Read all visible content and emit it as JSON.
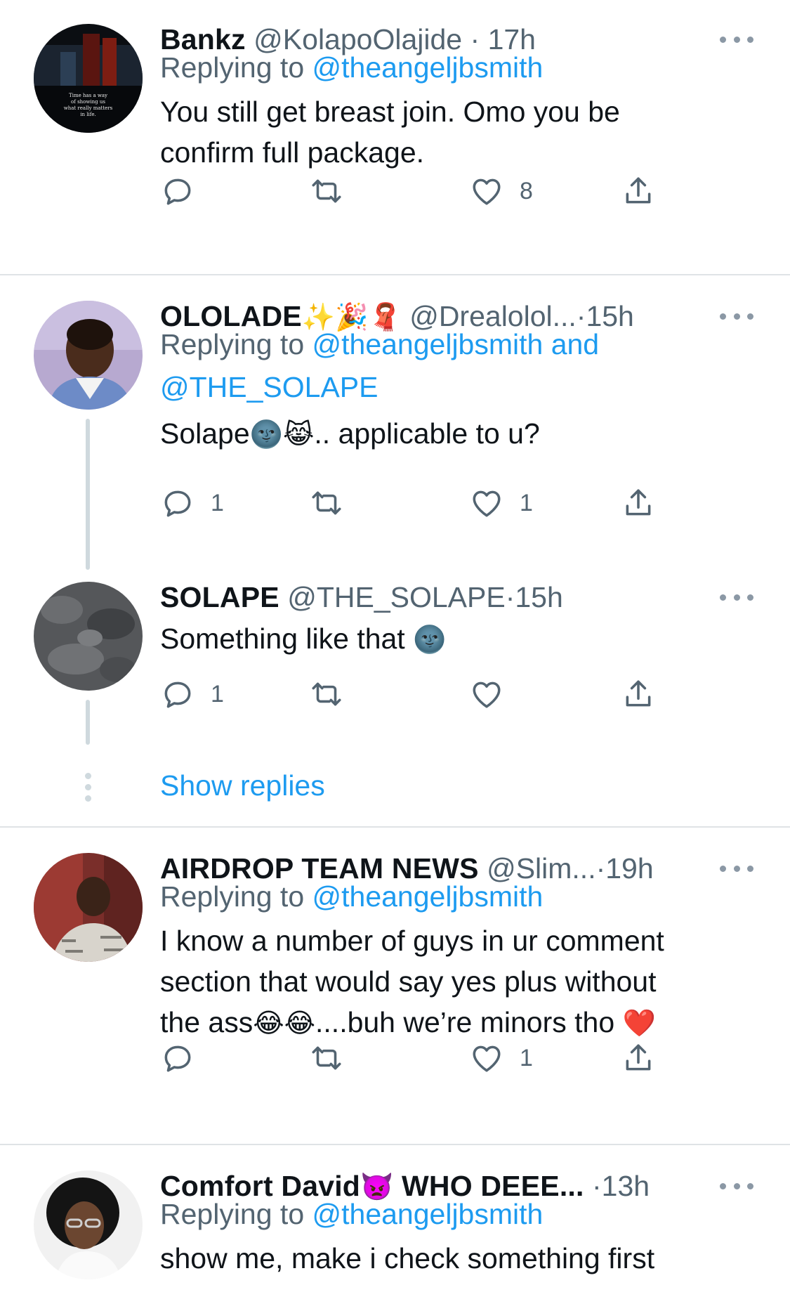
{
  "colors": {
    "link": "#1d9bf0",
    "secondary": "#536471",
    "text": "#0f1419",
    "divider": "#dfe3e6",
    "thread_line": "#cfd9de"
  },
  "tweets": [
    {
      "name": "Bankz",
      "handle": "@KolapoOlajide",
      "dot": "·",
      "time": "17h",
      "replying_prefix": "Replying to ",
      "replying_link": "@theangeljbsmith",
      "body_lines": [
        "You still get breast join. Omo you be",
        "confirm full package."
      ],
      "counts": {
        "reply": "",
        "retweet": "",
        "like": "8"
      },
      "avatar_text": [
        "Time has a way",
        "of showing us",
        "what really matters",
        "in life."
      ]
    },
    {
      "name": "OLOLADE",
      "name_emoji": "✨🎉🧣",
      "handle": "@Drealolol...",
      "dot": "·",
      "time": "15h",
      "replying_prefix": "Replying to ",
      "replying_link": "@theangeljbsmith and",
      "replying_link2": "@THE_SOLAPE",
      "body_parts": [
        "Solape",
        "🌚😹",
        ".. applicable to u?"
      ],
      "counts": {
        "reply": "1",
        "retweet": "",
        "like": "1"
      }
    },
    {
      "name": "SOLAPE",
      "handle": "@THE_SOLAPE",
      "dot": "·",
      "time": "15h",
      "body_parts": [
        "Something like that ",
        "🌚"
      ],
      "counts": {
        "reply": "1",
        "retweet": "",
        "like": ""
      }
    },
    {
      "name": "AIRDROP TEAM NEWS",
      "handle": "@Slim...",
      "dot": "·",
      "time": "19h",
      "replying_prefix": "Replying to ",
      "replying_link": "@theangeljbsmith",
      "body_lines": [
        "I know a number of guys in ur comment",
        "section that would say yes plus without"
      ],
      "body_line3_parts": [
        "the ass",
        "😂😂",
        "....buh we’re minors tho ",
        "❤️"
      ],
      "counts": {
        "reply": "",
        "retweet": "",
        "like": "1"
      }
    },
    {
      "name": "Comfort David",
      "name_emoji": "👿",
      "name_suffix": " WHO DEEE...",
      "dot": "·",
      "time": "13h",
      "replying_prefix": "Replying to ",
      "replying_link": "@theangeljbsmith",
      "body_lines": [
        "show me, make i check something first"
      ]
    }
  ],
  "show_replies": "Show replies",
  "icons": {
    "reply": "reply-icon",
    "retweet": "retweet-icon",
    "like": "heart-icon",
    "share": "share-icon",
    "more": "more-icon"
  }
}
